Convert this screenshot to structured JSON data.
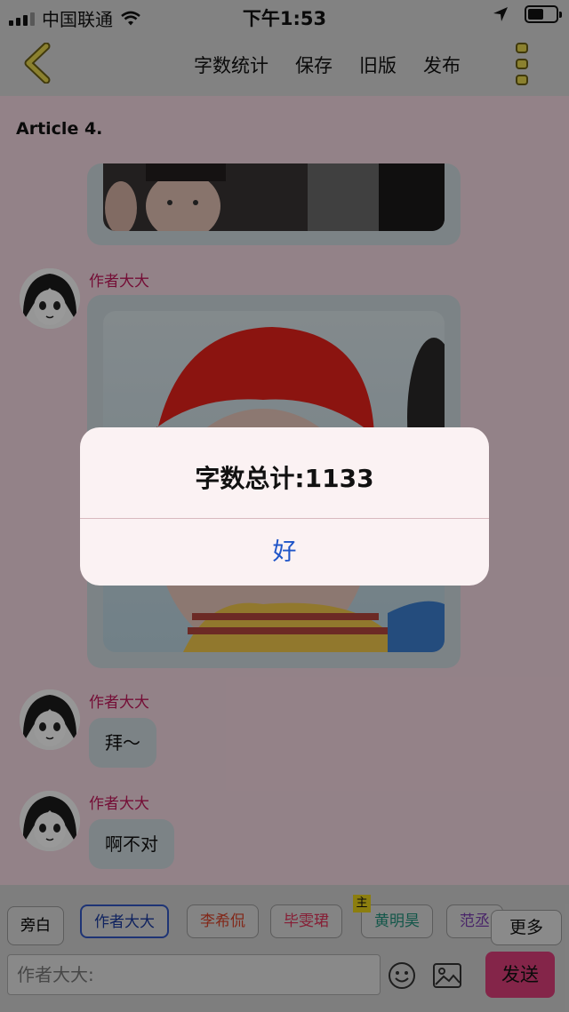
{
  "status_bar": {
    "carrier": "中国联通",
    "time": "下午1:53"
  },
  "nav": {
    "actions": [
      "字数统计",
      "保存",
      "旧版",
      "发布"
    ],
    "back_icon": "chevron-left-icon",
    "more_icon": "vertical-dots-icon"
  },
  "article": {
    "title": "Article 4."
  },
  "messages": [
    {
      "type": "image",
      "sender": ""
    },
    {
      "type": "image",
      "sender": "作者大大"
    },
    {
      "type": "text",
      "sender": "作者大大",
      "text": "拜～"
    },
    {
      "type": "text",
      "sender": "作者大大",
      "text": "啊不对"
    }
  ],
  "roles": [
    {
      "label": "旁白",
      "color": "#111111"
    },
    {
      "label": "作者大大",
      "color": "#1a3a9f",
      "selected": true
    },
    {
      "label": "李希侃",
      "color": "#d9432a"
    },
    {
      "label": "毕雯珺",
      "color": "#e0355a"
    },
    {
      "label": "黄明昊",
      "color": "#1f8f7a",
      "badge": "主"
    },
    {
      "label": "范丞",
      "color": "#7b3fb0"
    }
  ],
  "more_button": "更多",
  "input": {
    "placeholder": "作者大大:"
  },
  "send_button": "发送",
  "dialog": {
    "title": "字数总计:1133",
    "ok": "好"
  },
  "colors": {
    "accent": "#dc3e7b",
    "sender": "#c2185b",
    "dialog_button": "#1f55c8"
  }
}
